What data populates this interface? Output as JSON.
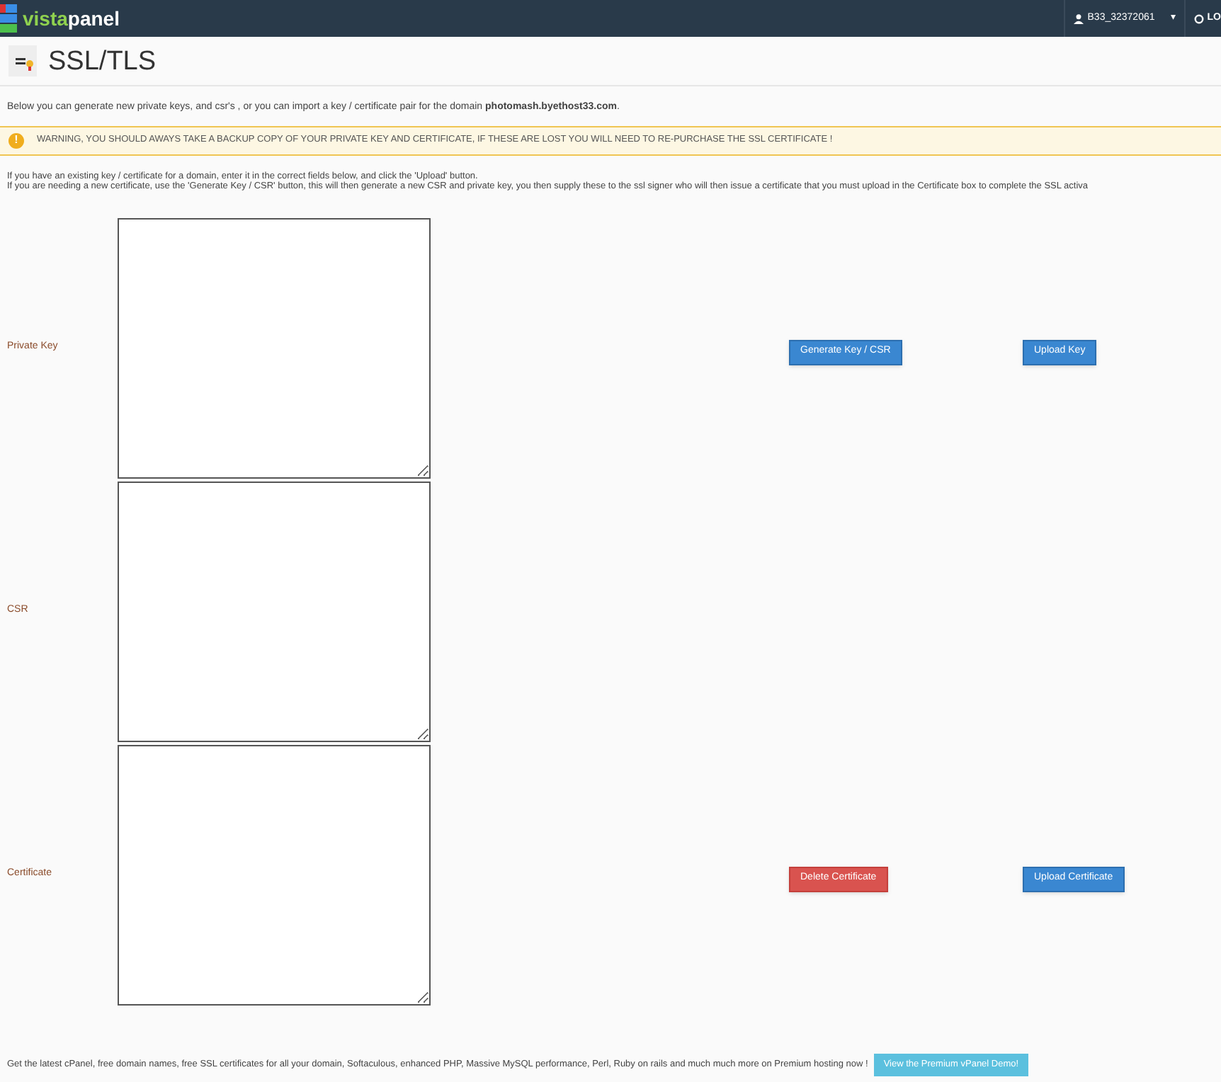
{
  "header": {
    "logo": {
      "part_1": "vista",
      "part_2": "panel"
    },
    "user": "B33_32372061",
    "caret": "▾",
    "logout": "LO"
  },
  "page": {
    "title": "SSL/TLS"
  },
  "intro": {
    "text": "Below you can generate new private keys, and csr's , or you can import a key / certificate pair for the domain **photomash.byethost33.com**."
  },
  "warning": {
    "icon": "!",
    "text": "WARNING, YOU SHOULD AWAYS TAKE A BACKUP COPY OF YOUR PRIVATE KEY AND CERTIFICATE, IF THESE ARE LOST YOU WILL NEED TO RE-PURCHASE THE SSL CERTIFICATE !"
  },
  "info": [
    "If you have an existing key / certificate for a domain, enter it in the correct fields below, and click the 'Upload' button.",
    "If you are needing a new certificate, use the 'Generate Key / CSR' button, this will then generate a new CSR and private key, you then supply these to the ssl signer who will then issue a certificate that you must upload in the Certificate box to complete the SSL activa"
  ],
  "rows": [
    {
      "label": "Private Key",
      "buttons": [
        {
          "label": "Generate Key / CSR",
          "kind": "primary"
        },
        {
          "label": "Upload Key",
          "kind": "primary"
        }
      ]
    },
    {
      "label": "CSR",
      "buttons": []
    },
    {
      "label": "Certificate",
      "buttons": [
        {
          "label": "Delete Certificate",
          "kind": "danger"
        },
        {
          "label": "Upload Certificate",
          "kind": "primary"
        }
      ]
    }
  ],
  "footer": {
    "text": "Get the latest cPanel, free domain names, free SSL certificates for all your domain, Softaculous, enhanced PHP, Massive MySQL performance, Perl, Ruby on rails and much much more on Premium hosting now !",
    "button": "View the Premium vPanel Demo!"
  }
}
